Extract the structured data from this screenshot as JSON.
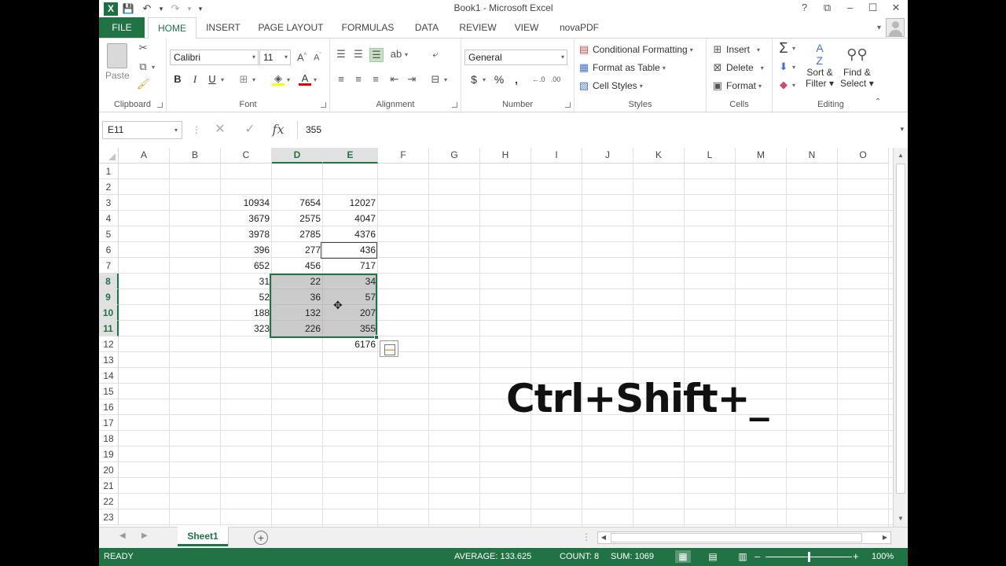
{
  "window": {
    "title": "Book1 - Microsoft Excel",
    "help": "?",
    "ribbon_display": "⧉",
    "minimize": "–",
    "maximize": "☐",
    "close": "✕"
  },
  "qat": {
    "logo": "X",
    "save": "💾",
    "undo": "↶",
    "undo_dd": "▾",
    "redo": "↷",
    "redo_dd": "▾",
    "customize": "▾"
  },
  "tabs": [
    "FILE",
    "HOME",
    "INSERT",
    "PAGE LAYOUT",
    "FORMULAS",
    "DATA",
    "REVIEW",
    "VIEW",
    "novaPDF"
  ],
  "ribbon": {
    "clipboard": {
      "label": "Clipboard",
      "paste": "Paste"
    },
    "font": {
      "label": "Font",
      "name": "Calibri",
      "size": "11",
      "bold": "B",
      "italic": "I",
      "underline": "U"
    },
    "alignment": {
      "label": "Alignment"
    },
    "number": {
      "label": "Number",
      "format": "General",
      "currency": "$",
      "percent": "%",
      "comma": ","
    },
    "styles": {
      "label": "Styles",
      "conditional": "Conditional Formatting",
      "format_table": "Format as Table",
      "cell_styles": "Cell Styles"
    },
    "cells": {
      "label": "Cells",
      "insert": "Insert",
      "delete": "Delete",
      "format": "Format"
    },
    "editing": {
      "label": "Editing",
      "sort1": "Sort &",
      "sort2": "Filter",
      "find1": "Find &",
      "find2": "Select",
      "sum": "Σ"
    }
  },
  "formula_bar": {
    "name_box": "E11",
    "cancel": "✕",
    "enter": "✓",
    "fx": "fx",
    "value": "355"
  },
  "columns": [
    "A",
    "B",
    "C",
    "D",
    "E",
    "F",
    "G",
    "H",
    "I",
    "J",
    "K",
    "L",
    "M",
    "N",
    "O"
  ],
  "rows": [
    "1",
    "2",
    "3",
    "4",
    "5",
    "6",
    "7",
    "8",
    "9",
    "10",
    "11",
    "12",
    "13",
    "14",
    "15",
    "16",
    "17",
    "18",
    "19",
    "20",
    "21",
    "22",
    "23"
  ],
  "cells": {
    "C3": "10934",
    "D3": "7654",
    "E3": "12027",
    "C4": "3679",
    "D4": "2575",
    "E4": "4047",
    "C5": "3978",
    "D5": "2785",
    "E5": "4376",
    "C6": "396",
    "D6": "277",
    "E6": "436",
    "C7": "652",
    "D7": "456",
    "E7": "717",
    "C8": "31",
    "D8": "22",
    "E8": "34",
    "C9": "52",
    "D9": "36",
    "E9": "57",
    "C10": "188",
    "D10": "132",
    "E10": "207",
    "C11": "323",
    "D11": "226",
    "E11": "355",
    "E12": "6176"
  },
  "overlay": "Ctrl+Shift+_",
  "sheet": {
    "name": "Sheet1",
    "add": "+"
  },
  "status": {
    "mode": "READY",
    "average": "AVERAGE: 133.625",
    "count": "COUNT: 8",
    "sum": "SUM: 1069",
    "zoom": "100%",
    "zoom_out": "–",
    "zoom_in": "+"
  },
  "colors": {
    "accent": "#217346",
    "selection": "#a0a0a0"
  }
}
